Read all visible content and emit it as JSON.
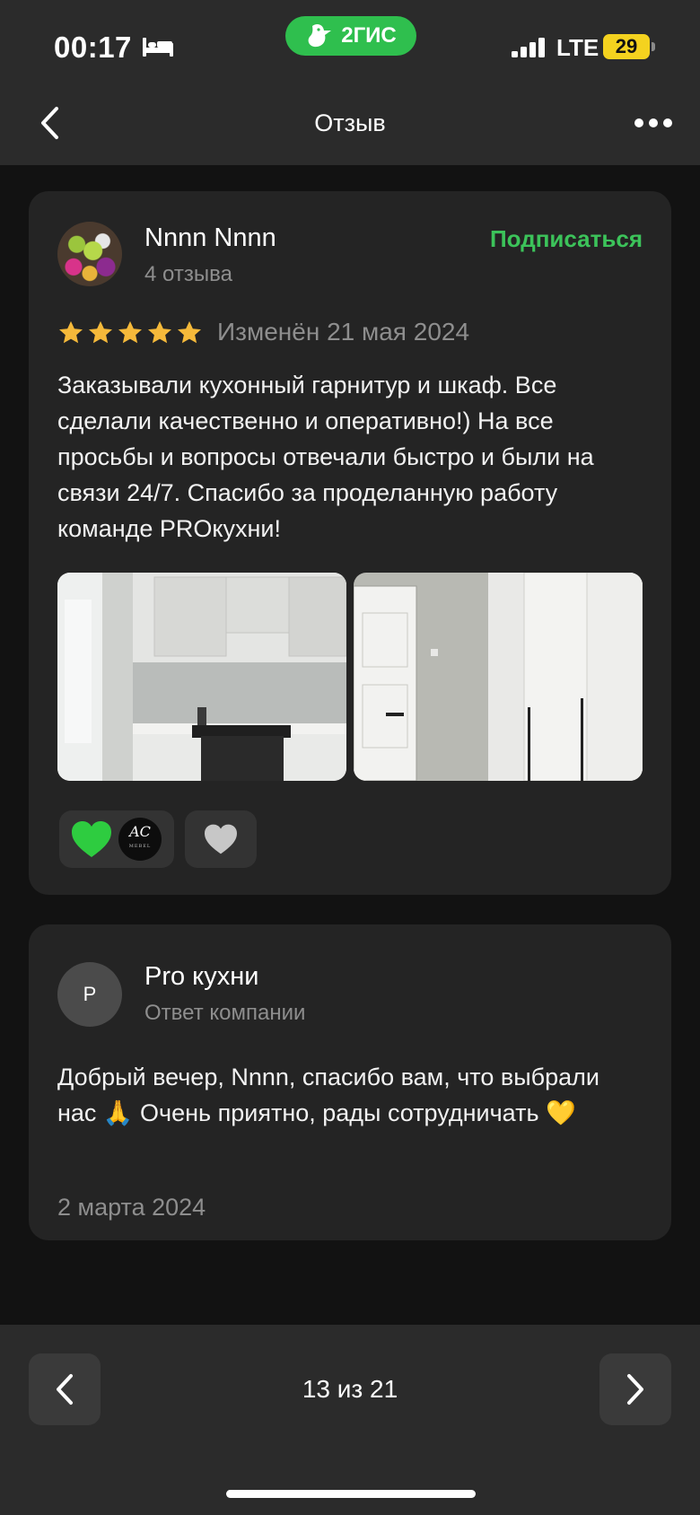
{
  "status_bar": {
    "time": "00:17",
    "app_name": "2ГИС",
    "network": "LTE",
    "battery": "29",
    "colors": {
      "app_pill": "#2fbf4e",
      "battery": "#f4d21f"
    },
    "icons": [
      "bed-icon",
      "signal-icon"
    ]
  },
  "header": {
    "title": "Отзыв",
    "icons": [
      "chevron-left-icon",
      "more-dots-icon"
    ]
  },
  "review": {
    "author_name": "Nnnn Nnnn",
    "author_reviews": "4 отзыва",
    "subscribe_label": "Подписаться",
    "rating": 5,
    "rating_max": 5,
    "edited_label": "Изменён 21 мая 2024",
    "text": "Заказывали кухонный гарнитур и шкаф. Все сделали качественно и оперативно!) На все просьбы и вопросы отвечали быстро и были на связи 24/7. Спасибо за проделанную работу команде PROкухни!",
    "photos": [
      "kitchen-photo",
      "wardrobe-photo"
    ],
    "reaction_mini_avatar": "AC",
    "reaction_mini_avatar_sub": "MEBEL",
    "icons": [
      "green-heart-icon",
      "heart-icon",
      "star-icon"
    ],
    "colors": {
      "accent": "#3cc35a",
      "star": "#f5b93a",
      "green_heart": "#2ecc40"
    }
  },
  "reply": {
    "avatar_letter": "P",
    "company_name": "Pro кухни",
    "company_label": "Ответ компании",
    "text": "Добрый вечер, Nnnn, спасибо вам, что выбрали нас 🙏 Очень приятно, рады сотрудничать 💛",
    "date": "2 марта 2024"
  },
  "pager": {
    "counter": "13 из 21",
    "icons": [
      "chevron-left-icon",
      "chevron-right-icon"
    ]
  }
}
